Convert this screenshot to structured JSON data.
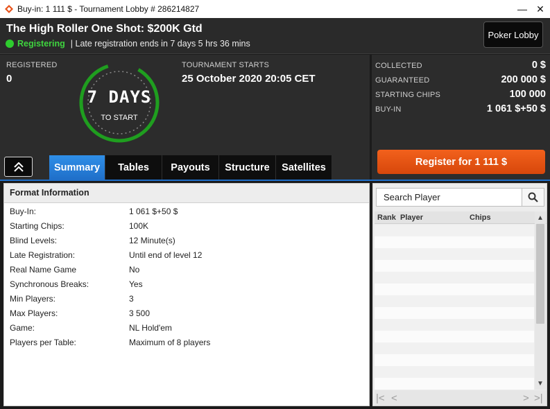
{
  "window": {
    "title": "Buy-in: 1 111 $ - Tournament Lobby # 286214827",
    "minimize": "—",
    "close": "✕"
  },
  "header": {
    "tournament_name": "The High Roller One Shot: $200K Gtd",
    "status": "Registering",
    "late_registration": "| Late registration ends in 7 days 5 hrs  36 mins",
    "poker_lobby_label": "Poker Lobby"
  },
  "info": {
    "registered_label": "REGISTERED",
    "registered_value": "0",
    "countdown_days": "7 DAYS",
    "countdown_sub": "TO START",
    "starts_label": "TOURNAMENT STARTS",
    "starts_value": "25 October 2020  20:05 CET"
  },
  "prize": {
    "collected_label": "COLLECTED",
    "collected_value": "0 $",
    "guaranteed_label": "GUARANTEED",
    "guaranteed_value": "200 000 $",
    "starting_chips_label": "STARTING CHIPS",
    "starting_chips_value": "100 000",
    "buyin_label": "BUY-IN",
    "buyin_value": "1 061 $+50 $"
  },
  "register_button": "Register for  1 111 $",
  "tabs": [
    "Summary",
    "Tables",
    "Payouts",
    "Structure",
    "Satellites"
  ],
  "format": {
    "heading": "Format Information",
    "rows": [
      {
        "key": "Buy-In:",
        "value": "1 061 $+50 $"
      },
      {
        "key": "Starting Chips:",
        "value": "100K"
      },
      {
        "key": "Blind Levels:",
        "value": "12 Minute(s)"
      },
      {
        "key": "Late Registration:",
        "value": "Until end of level 12"
      },
      {
        "key": "Real Name Game",
        "value": "No"
      },
      {
        "key": "Synchronous Breaks:",
        "value": "Yes"
      },
      {
        "key": "Min Players:",
        "value": "3"
      },
      {
        "key": "Max Players:",
        "value": "3 500"
      },
      {
        "key": "Game:",
        "value": "NL Hold'em"
      },
      {
        "key": "Players per Table:",
        "value": "Maximum of 8 players"
      }
    ]
  },
  "players": {
    "search_placeholder": "Search Player",
    "columns": [
      "Rank",
      "Player",
      "Chips"
    ]
  },
  "colors": {
    "accent_blue": "#1f6fc9",
    "register_orange": "#e8531a",
    "status_green": "#2ecc2e"
  }
}
